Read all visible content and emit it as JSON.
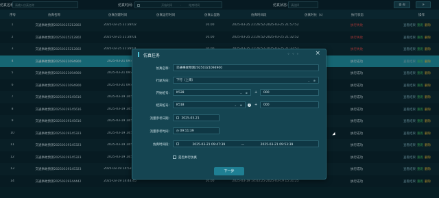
{
  "filter": {
    "name_label": "仿真名称:",
    "name_placeholder": "请输入仿真名称",
    "time_label": "仿真时间:",
    "start_placeholder": "开始时间",
    "separator": "-",
    "end_placeholder": "结束时间",
    "status_label": "仿真状态:",
    "status_placeholder": "请选择",
    "query_button": "查 询",
    "reset_icon": "refresh-icon"
  },
  "table": {
    "headers": [
      "序号",
      "仿真名称",
      "仿真创建时间",
      "仿真运行时间",
      "仿真公里数",
      "仿真时间段",
      "仿真时长（s）",
      "执行状态",
      "操作"
    ],
    "rows": [
      {
        "no": "1",
        "name": "交通事故预测20250325212802",
        "created": "2025-03-25 21:28:02",
        "run": "",
        "km": "10.00",
        "range": "2025-03-25 21:26:52-2025-03-25 21:57:52",
        "duration": "",
        "status": "执行失败"
      },
      {
        "no": "2",
        "name": "交通事故预测20250325212802",
        "created": "2025-03-25 21:28:01",
        "run": "",
        "km": "10.00",
        "range": "2025-03-25 21:26:52-2025-03-25 21:32:52",
        "duration": "",
        "status": "执行失败"
      },
      {
        "no": "3",
        "name": "交通事故预测20250325212802",
        "created": "2025-03-25 21:28:01",
        "run": "",
        "km": "10.00",
        "range": "2025-03-25 21:26:52-2025-03-25 21:32:52",
        "duration": "",
        "status": "执行失败"
      },
      {
        "no": "4",
        "name": "交通事故预测20250321094900",
        "created": "2025-03-21 09:4",
        "run": "",
        "km": "",
        "range": "",
        "duration": "",
        "status": "执行成功"
      },
      {
        "no": "5",
        "name": "交通事故预测20250321094900",
        "created": "2025-03-21 09:4",
        "run": "",
        "km": "",
        "range": "",
        "duration": "",
        "status": "执行成功"
      },
      {
        "no": "6",
        "name": "交通事故预测20250321094900",
        "created": "2025-03-21 09:4",
        "run": "",
        "km": "",
        "range": "",
        "duration": "",
        "status": "执行成功"
      },
      {
        "no": "7",
        "name": "交通事故预测20250319145616",
        "created": "2025-03-19 14:5",
        "run": "",
        "km": "",
        "range": "",
        "duration": "",
        "status": "执行成功"
      },
      {
        "no": "8",
        "name": "交通事故预测20250319145616",
        "created": "2025-03-19 14:5",
        "run": "",
        "km": "",
        "range": "",
        "duration": "",
        "status": "执行成功"
      },
      {
        "no": "9",
        "name": "交通事故预测20250319145616",
        "created": "2025-03-19 14:5",
        "run": "",
        "km": "",
        "range": "",
        "duration": "",
        "status": "执行成功"
      },
      {
        "no": "10",
        "name": "交通事故预测20250319145323",
        "created": "2025-03-19 14:5",
        "run": "",
        "km": "",
        "range": "",
        "duration": "",
        "status": "执行成功"
      },
      {
        "no": "11",
        "name": "交通事故预测20250319145323",
        "created": "2025-03-19 14:5",
        "run": "",
        "km": "",
        "range": "",
        "duration": "",
        "status": "执行成功"
      },
      {
        "no": "12",
        "name": "交通事故预测20250319145323",
        "created": "2025-03-19 14:5",
        "run": "",
        "km": "",
        "range": "",
        "duration": "",
        "status": "执行成功"
      },
      {
        "no": "13",
        "name": "交通事故预测20250319145323",
        "created": "2025-03-19 14:53:23",
        "run": "",
        "km": "10.00",
        "range": "2025-03-19 14:53:11-2025-03-19 15:14:11",
        "duration": "",
        "status": "执行成功"
      },
      {
        "no": "14",
        "name": "交通事故预测20250319144442",
        "created": "2025-03-19 14:44:45",
        "run": "",
        "km": "10.00",
        "range": "2025-03-19 14:43:25-2025-03-19 15:31:25",
        "duration": "",
        "status": "执行成功"
      }
    ],
    "op_view": "查看结果",
    "op_rerun": "重跑",
    "op_delete": "删除"
  },
  "modal": {
    "title": "仿真任务",
    "name_label": "仿真名称:",
    "name_value": "交通事故预测20250321094900",
    "direction_label": "行驶方向:",
    "direction_value": "下行（上海）",
    "start_label": "开始桩号:",
    "start_value": "K528",
    "start_offset": "000",
    "end_label": "结束桩号:",
    "end_value": "K518",
    "end_offset": "000",
    "plus": "+",
    "ref_date_label": "流量参考日期:",
    "ref_date_value": "2025-03-21",
    "ref_time_label": "流量参考时间:",
    "ref_time_value": "09:11:39",
    "sim_time_label": "仿真时间段:",
    "sim_time_start": "2025-03-21 09:47:39",
    "sim_time_sep": "—",
    "sim_time_end": "2025-03-21 09:53:39",
    "parallel_label": "是否并行仿真",
    "next_button": "下一步",
    "colors": {
      "accent": "#1f7f93",
      "fail": "#e04a4a",
      "highlight_row": "#1f8ea0"
    }
  }
}
